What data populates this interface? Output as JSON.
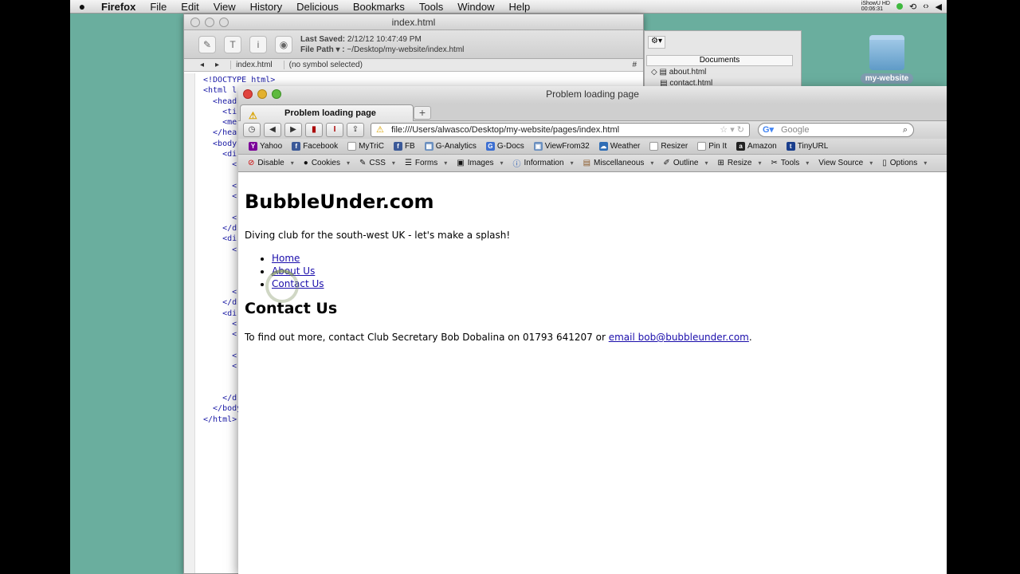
{
  "menubar": {
    "app": "Firefox",
    "items": [
      "File",
      "Edit",
      "View",
      "History",
      "Delicious",
      "Bookmarks",
      "Tools",
      "Window",
      "Help"
    ],
    "ishow_line1": "iShowU HD",
    "ishow_line2": "00:06:31"
  },
  "desktop": {
    "folder_label": "my-website"
  },
  "editor": {
    "title": "index.html",
    "last_saved_label": "Last Saved:",
    "last_saved": "2/12/12 10:47:49 PM",
    "file_path_label": "File Path ▾ :",
    "file_path": "~/Desktop/my-website/index.html",
    "nav_file": "index.html",
    "nav_symbol": "(no symbol selected)",
    "nav_hash": "#",
    "code_lines": [
      "<!DOCTYPE html>",
      "<html l",
      "  <head",
      "    <ti",
      "    <me",
      "  </hea",
      "  <body",
      "    <di",
      "      <",
      "",
      "      <",
      "      <",
      "",
      "      <",
      "    </d",
      "    <di",
      "      <",
      "",
      "",
      "",
      "      <",
      "    </d",
      "    <di",
      "      <",
      "      <",
      "",
      "      <",
      "      <",
      "",
      "",
      "    </d",
      "  </body",
      "</html>"
    ]
  },
  "documents": {
    "header": "Documents",
    "items": [
      "about.html",
      "contact.html"
    ]
  },
  "firefox": {
    "title": "Problem loading page",
    "tab_title": "Problem loading page",
    "url": "file:///Users/alwasco/Desktop/my-website/pages/index.html",
    "search_placeholder": "Google",
    "bookmarks": [
      "Yahoo",
      "Facebook",
      "MyTriC",
      "FB",
      "G-Analytics",
      "G-Docs",
      "ViewFrom32",
      "Weather",
      "Resizer",
      "Pin It",
      "Amazon",
      "TinyURL"
    ],
    "webdev": [
      "Disable",
      "Cookies",
      "CSS",
      "Forms",
      "Images",
      "Information",
      "Miscellaneous",
      "Outline",
      "Resize",
      "Tools",
      "View Source",
      "Options"
    ]
  },
  "page": {
    "heading": "BubbleUnder.com",
    "tagline": "Diving club for the south-west UK - let's make a splash!",
    "nav": [
      "Home",
      "About Us",
      "Contact Us"
    ],
    "subheading": "Contact Us",
    "contact_text": "To find out more, contact Club Secretary Bob Dobalina on 01793 641207 or ",
    "email_link": "email bob@bubbleunder.com",
    "period": "."
  },
  "colors": {
    "desktop": "#6aae9e",
    "link": "#1a0dab"
  }
}
